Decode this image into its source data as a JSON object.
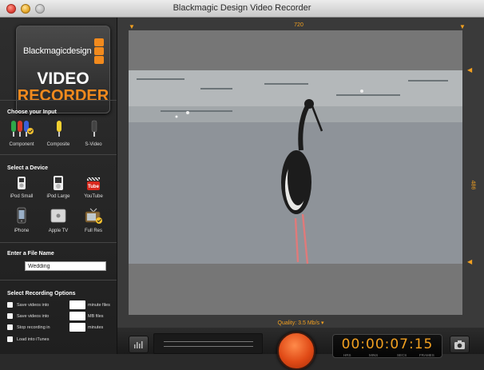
{
  "window": {
    "title": "Blackmagic Design Video Recorder"
  },
  "logo": {
    "brand": "Blackmagicdesign",
    "line1": "VIDEO",
    "line2": "RECORDER"
  },
  "input_section": {
    "title": "Choose your Input",
    "options": [
      {
        "label": "Component",
        "icon": "component-cable-icon"
      },
      {
        "label": "Composite",
        "icon": "composite-cable-icon"
      },
      {
        "label": "S-Video",
        "icon": "svideo-cable-icon"
      }
    ],
    "selected": "Component"
  },
  "device_section": {
    "title": "Select a Device",
    "devices": [
      {
        "label": "iPod Small",
        "icon": "ipod-small-icon"
      },
      {
        "label": "iPod Large",
        "icon": "ipod-large-icon"
      },
      {
        "label": "YouTube",
        "icon": "youtube-icon"
      },
      {
        "label": "iPhone",
        "icon": "iphone-icon"
      },
      {
        "label": "Apple TV",
        "icon": "apple-tv-icon"
      },
      {
        "label": "Full Res",
        "icon": "full-res-icon"
      }
    ],
    "selected": "Full Res"
  },
  "file_section": {
    "title": "Enter a File Name",
    "value": "Wedding"
  },
  "recording_options": {
    "title": "Select Recording Options",
    "options": [
      {
        "prefix": "Save videos into",
        "suffix": "minute files"
      },
      {
        "prefix": "Save videos into",
        "suffix": "MB files"
      },
      {
        "prefix": "Stop recording in",
        "suffix": "minutes"
      },
      {
        "label": "Load into iTunes"
      }
    ]
  },
  "preview": {
    "width_label": "720",
    "height_label": "486",
    "quality_label": "Quality: 3.5 Mb/s ▾"
  },
  "timecode": {
    "display": "00:00:07:15",
    "units": [
      "HRS",
      "MINS",
      "SECS",
      "FRAMES"
    ]
  },
  "colors": {
    "accent": "#f2a020",
    "record": "#e04a16",
    "water": "#8a9098",
    "bird_body": "#1c1c1c",
    "bird_legs": "#e07a7a"
  }
}
